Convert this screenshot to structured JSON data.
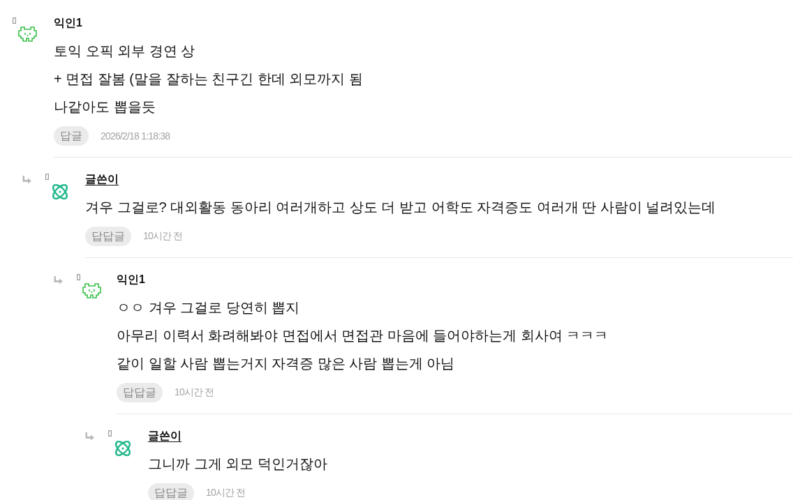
{
  "comments": [
    {
      "author": "익인1",
      "kind": "anonymous",
      "lines": [
        "토익 오픽 외부 경연 상",
        "+ 면접 잘봄 (말을 잘하는 친구긴 한데 외모까지 됨",
        "나같아도 뽑을듯"
      ],
      "reply_button": "답글",
      "time": "2026/2/18 1:18:38",
      "children": [
        {
          "author": "글쓴이",
          "kind": "writer",
          "lines": [
            "겨우 그걸로? 대외활동 동아리 여러개하고 상도 더 받고 어학도 자격증도 여러개 딴 사람이 널려있는데"
          ],
          "reply_button": "답답글",
          "time": "10시간 전",
          "children": [
            {
              "author": "익인1",
              "kind": "anonymous",
              "lines": [
                "ㅇㅇ 겨우 그걸로 당연히 뽑지",
                "아무리 이력서 화려해봐야 면접에서 면접관 마음에 들어야하는게 회사여 ㅋㅋㅋ",
                "같이 일할 사람 뽑는거지 자격증 많은 사람 뽑는게 아님"
              ],
              "reply_button": "답답글",
              "time": "10시간 전",
              "children": [
                {
                  "author": "글쓴이",
                  "kind": "writer",
                  "lines": [
                    "그니까 그게 외모 덕인거잖아"
                  ],
                  "reply_button": "답답글",
                  "time": "10시간 전"
                }
              ]
            }
          ]
        }
      ]
    }
  ]
}
